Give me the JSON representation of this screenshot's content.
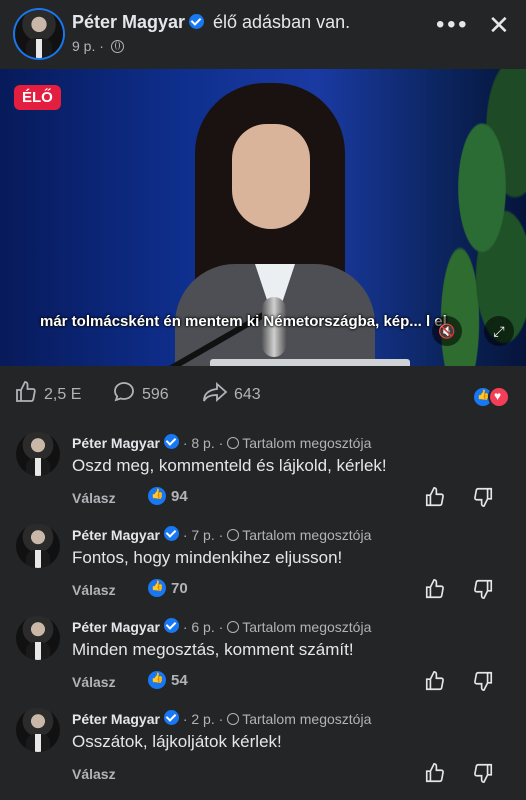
{
  "header": {
    "name": "Péter Magyar",
    "live_text": "élő adásban van.",
    "time": "9 p. ·"
  },
  "video": {
    "live_badge": "ÉLŐ",
    "subtitle": "már tolmácsként én mentem ki Németországba, kép... l el"
  },
  "actions": {
    "likes": "2,5 E",
    "comments": "596",
    "shares": "643"
  },
  "comments": [
    {
      "name": "Péter Magyar",
      "time": "· 8 p. ·",
      "role": "Tartalom megosztója",
      "text": "Oszd meg, kommenteld és lájkold, kérlek!",
      "reply": "Válasz",
      "likes": "94"
    },
    {
      "name": "Péter Magyar",
      "time": "· 7 p. ·",
      "role": "Tartalom megosztója",
      "text": "Fontos, hogy mindenkihez eljusson!",
      "reply": "Válasz",
      "likes": "70"
    },
    {
      "name": "Péter Magyar",
      "time": "· 6 p. ·",
      "role": "Tartalom megosztója",
      "text": "Minden megosztás, komment számít!",
      "reply": "Válasz",
      "likes": "54"
    },
    {
      "name": "Péter Magyar",
      "time": "· 2 p. ·",
      "role": "Tartalom megosztója",
      "text": "Osszátok, lájkoljátok kérlek!",
      "reply": "Válasz",
      "likes": ""
    }
  ],
  "colors": {
    "background": "#242526",
    "accent": "#1877f2",
    "live": "#e41e3f",
    "love": "#f33e58"
  }
}
